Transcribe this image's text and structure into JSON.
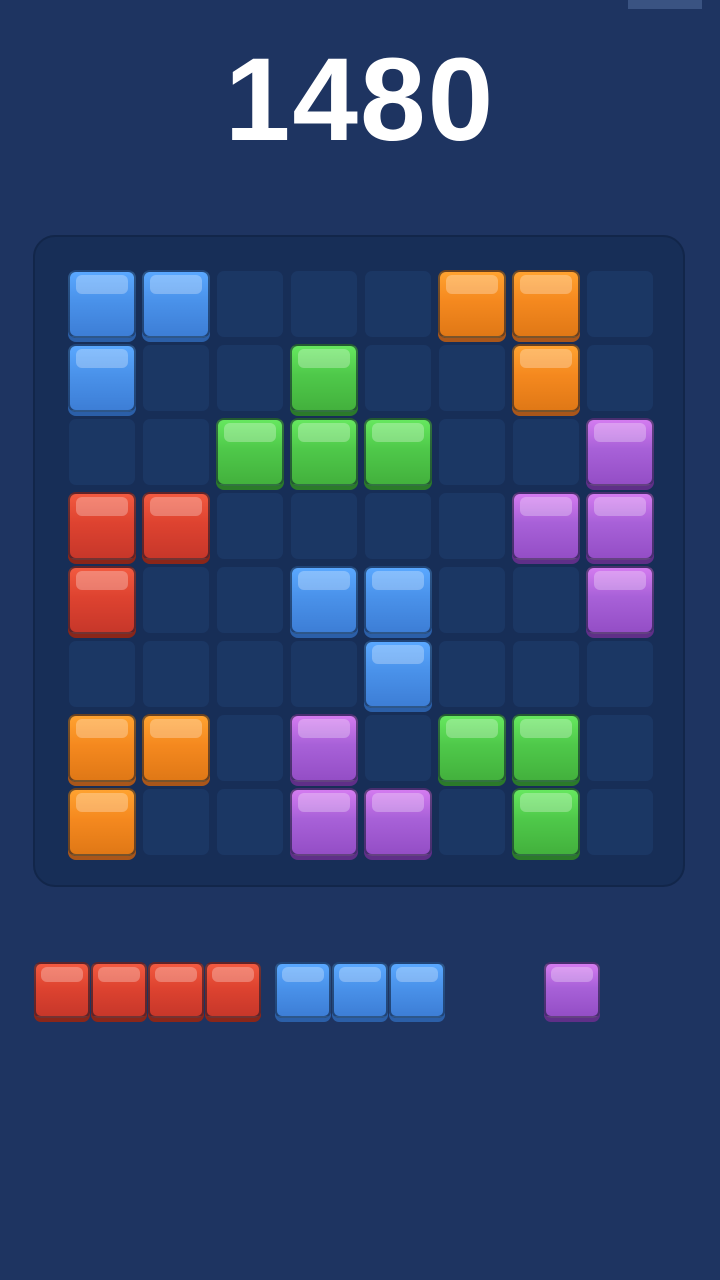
{
  "score": "1480",
  "board": {
    "rows": 8,
    "cols": 8,
    "cells": [
      [
        "blue",
        "blue",
        "",
        "",
        "",
        "orange",
        "orange",
        ""
      ],
      [
        "blue",
        "",
        "",
        "green",
        "",
        "",
        "orange",
        ""
      ],
      [
        "",
        "",
        "green",
        "green",
        "green",
        "",
        "",
        "purple"
      ],
      [
        "red",
        "red",
        "",
        "",
        "",
        "",
        "purple",
        "purple"
      ],
      [
        "red",
        "",
        "",
        "blue",
        "blue",
        "",
        "",
        "purple"
      ],
      [
        "",
        "",
        "",
        "",
        "blue",
        "",
        "",
        ""
      ],
      [
        "orange",
        "orange",
        "",
        "purple",
        "",
        "green",
        "green",
        ""
      ],
      [
        "orange",
        "",
        "",
        "purple",
        "purple",
        "",
        "green",
        ""
      ]
    ]
  },
  "tray": {
    "pieces": [
      {
        "name": "tray-piece-red-line-4",
        "color": "red",
        "shape": [
          [
            1,
            1,
            1,
            1
          ]
        ]
      },
      {
        "name": "tray-piece-blue-line-3",
        "color": "blue",
        "shape": [
          [
            1,
            1,
            1
          ]
        ]
      },
      {
        "name": "tray-piece-purple-single",
        "color": "purple",
        "shape": [
          [
            1
          ]
        ]
      }
    ]
  },
  "colors": {
    "background": "#1e3461",
    "board": "#172e57",
    "empty_cell": "#1b3764",
    "blue": "#4a92ea",
    "orange": "#f5891f",
    "green": "#4fc94a",
    "purple": "#a861d8",
    "red": "#de4330"
  }
}
